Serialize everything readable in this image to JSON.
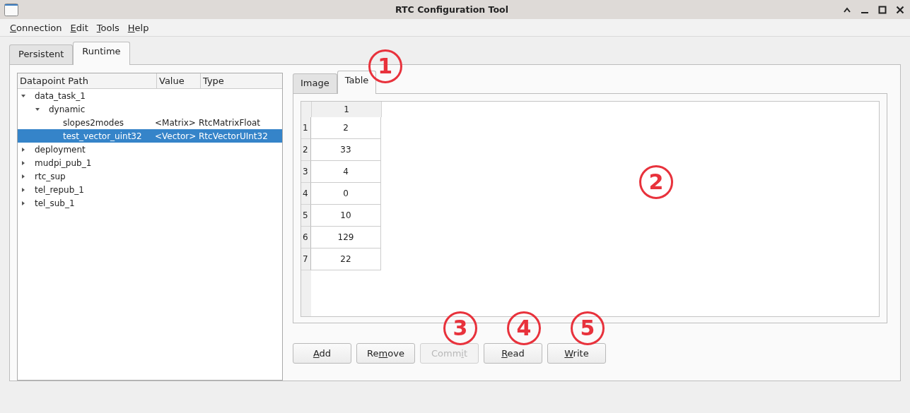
{
  "window": {
    "title": "RTC Configuration Tool"
  },
  "menu": [
    {
      "accel": "C",
      "after": "onnection"
    },
    {
      "accel": "E",
      "after": "dit"
    },
    {
      "accel": "T",
      "after": "ools"
    },
    {
      "accel": "H",
      "after": "elp"
    }
  ],
  "tabs": [
    {
      "label": "Persistent",
      "selected": false
    },
    {
      "label": "Runtime",
      "selected": true
    }
  ],
  "tree": {
    "columns": [
      "Datapoint Path",
      "Value",
      "Type"
    ],
    "items": [
      {
        "path": "data_task_1",
        "expanded": true,
        "selected": false,
        "children": [
          {
            "path": "dynamic",
            "expanded": true,
            "selected": false,
            "children": [
              {
                "path": "slopes2modes",
                "value": "<Matrix>",
                "type": "RtcMatrixFloat",
                "selected": false
              },
              {
                "path": "test_vector_uint32",
                "value": "<Vector>",
                "type": "RtcVectorUInt32",
                "selected": true
              }
            ]
          }
        ]
      },
      {
        "path": "deployment",
        "expanded": false,
        "selected": false
      },
      {
        "path": "mudpi_pub_1",
        "expanded": false,
        "selected": false
      },
      {
        "path": "rtc_sup",
        "expanded": false,
        "selected": false
      },
      {
        "path": "tel_repub_1",
        "expanded": false,
        "selected": false
      },
      {
        "path": "tel_sub_1",
        "expanded": false,
        "selected": false
      }
    ]
  },
  "view_tabs": [
    {
      "label": "Image",
      "selected": false
    },
    {
      "label": "Table",
      "selected": true,
      "callout": "1"
    }
  ],
  "table": {
    "callout": "2",
    "columns": [
      "1"
    ],
    "rows": [
      {
        "header": "1",
        "cells": [
          "2"
        ]
      },
      {
        "header": "2",
        "cells": [
          "33"
        ]
      },
      {
        "header": "3",
        "cells": [
          "4"
        ]
      },
      {
        "header": "4",
        "cells": [
          "0"
        ]
      },
      {
        "header": "5",
        "cells": [
          "10"
        ]
      },
      {
        "header": "6",
        "cells": [
          "129"
        ]
      },
      {
        "header": "7",
        "cells": [
          "22"
        ]
      }
    ]
  },
  "buttons": [
    {
      "accel": "A",
      "after": "dd",
      "disabled": false
    },
    {
      "before": "Re",
      "accel": "m",
      "after": "ove",
      "disabled": false
    },
    {
      "before": "Comm",
      "accel": "i",
      "after": "t",
      "disabled": true,
      "callout": "3"
    },
    {
      "accel": "R",
      "after": "ead",
      "disabled": false,
      "callout": "4"
    },
    {
      "accel": "W",
      "after": "rite",
      "disabled": false,
      "callout": "5"
    }
  ]
}
